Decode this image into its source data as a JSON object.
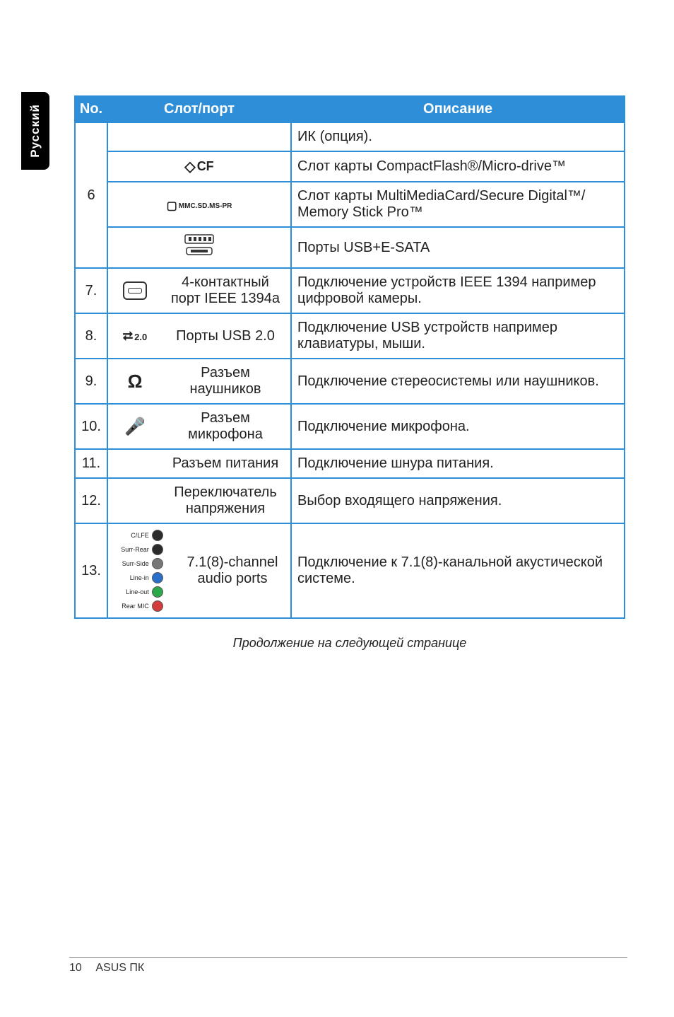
{
  "sideTab": "Русский",
  "headers": {
    "no": "No.",
    "slot": "Слот/порт",
    "desc": "Описание"
  },
  "group6": {
    "no": "6",
    "rows": [
      {
        "slot": "",
        "desc": "ИК (опция)."
      },
      {
        "slotIcon": "cf",
        "slotIconText": "CF",
        "desc": "Слот карты CompactFlash®/Micro-drive™"
      },
      {
        "slotIcon": "mmc",
        "slotIconText": "MMC.SD.MS-PR",
        "desc": "Слот карты MultiMediaCard/Secure Digital™/ Memory Stick Pro™"
      },
      {
        "slotIcon": "usbesata",
        "desc": "Порты USB+E-SATA"
      }
    ]
  },
  "rows": [
    {
      "no": "7.",
      "icon": "1394",
      "label": "4-контактный порт IEEE 1394a",
      "desc": "Подключение устройств IEEE 1394 например цифровой камеры."
    },
    {
      "no": "8.",
      "icon": "usb20",
      "iconText": "2.0",
      "label": "Порты USB 2.0",
      "desc": "Подключение USB устройств например клавиатуры, мыши."
    },
    {
      "no": "9.",
      "icon": "hp",
      "label": "Разъем наушников",
      "desc": "Подключение стереосистемы или наушников."
    },
    {
      "no": "10.",
      "icon": "mic",
      "label": "Разъем микрофона",
      "desc": "Подключение микрофона."
    },
    {
      "no": "11.",
      "label": "Разъем питания",
      "desc": "Подключение шнура питания."
    },
    {
      "no": "12.",
      "label": "Переключатель напряжения",
      "desc": "Выбор входящего напряжения."
    },
    {
      "no": "13.",
      "icon": "audio",
      "label": "7.1(8)-channel audio ports",
      "desc": "Подключение к 7.1(8)-канальной акустической системе."
    }
  ],
  "audioJacks": [
    {
      "label": "C/LFE",
      "color": "black"
    },
    {
      "label": "Surr-Rear",
      "color": "black"
    },
    {
      "label": "Surr-Side",
      "color": "gray"
    },
    {
      "label": "Line-in",
      "color": "blue"
    },
    {
      "label": "Line-out",
      "color": "green"
    },
    {
      "label": "Rear MIC",
      "color": "red"
    }
  ],
  "continued": "Продолжение на следующей странице",
  "footer": {
    "page": "10",
    "title": "ASUS ПК"
  }
}
